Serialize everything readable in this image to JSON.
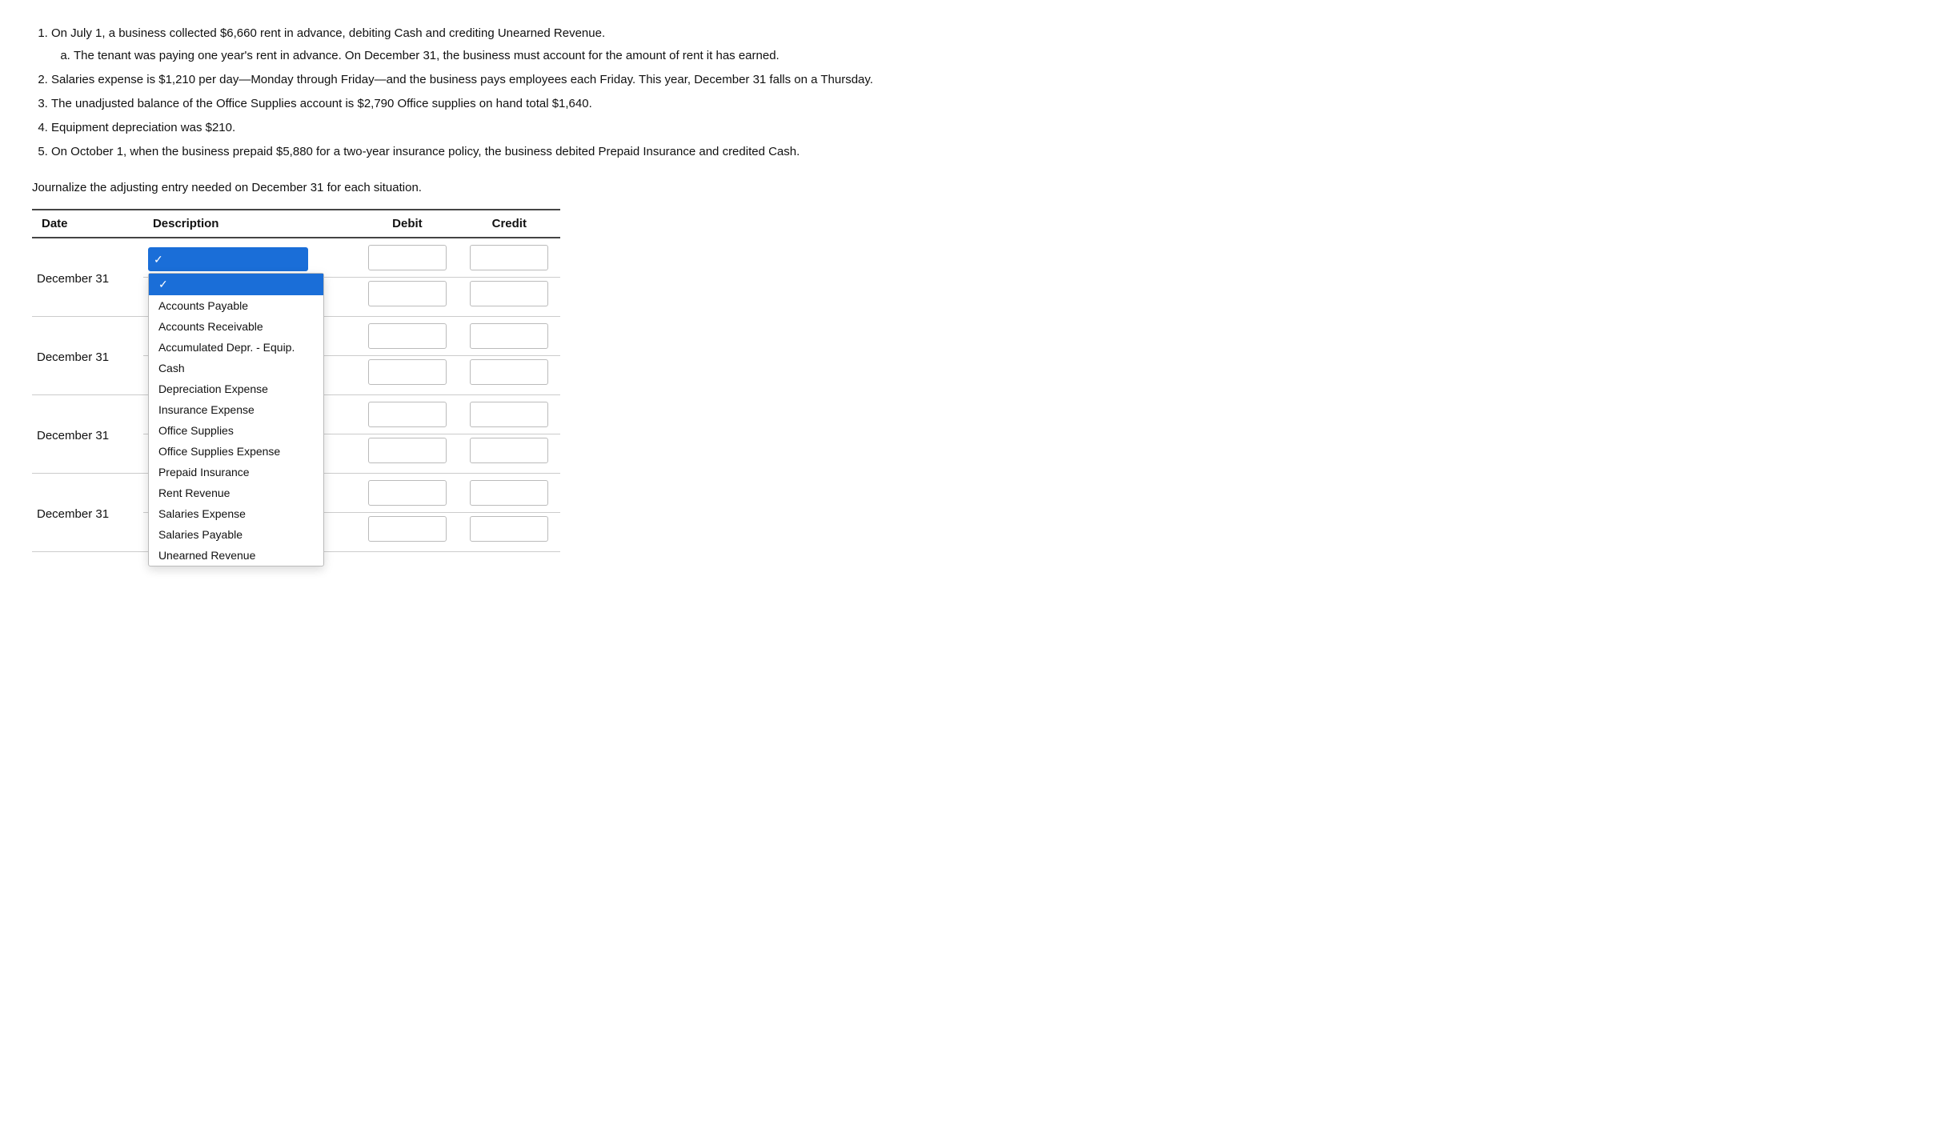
{
  "instructions": {
    "items": [
      {
        "text": "On July 1, a business collected $6,660 rent in advance, debiting Cash and crediting Unearned Revenue.",
        "sub": [
          "The tenant was paying one year's rent in advance. On December 31, the business must account for the amount of rent it has earned."
        ]
      },
      {
        "text": "Salaries expense is $1,210 per day—Monday through Friday—and the business pays employees each Friday. This year, December 31 falls on a Thursday.",
        "sub": []
      },
      {
        "text": "The unadjusted balance of the Office Supplies account is $2,790 Office supplies on hand total $1,640.",
        "sub": []
      },
      {
        "text": "Equipment depreciation was $210.",
        "sub": []
      },
      {
        "text": "On October 1, when the business prepaid $5,880 for a two-year insurance policy, the business debited Prepaid Insurance and credited Cash.",
        "sub": []
      }
    ]
  },
  "prompt": "Journalize the adjusting entry needed on December 31 for each situation.",
  "table": {
    "headers": {
      "date": "Date",
      "description": "Description",
      "debit": "Debit",
      "credit": "Credit"
    },
    "rows": [
      {
        "date": "December 31",
        "lines": [
          {
            "desc_selected": "",
            "desc_open": true,
            "debit": "",
            "credit": ""
          },
          {
            "desc_selected": "",
            "desc_open": false,
            "debit": "",
            "credit": "",
            "indented": true
          }
        ]
      },
      {
        "date": "December 31",
        "lines": [
          {
            "desc_selected": "",
            "desc_open": false,
            "debit": "",
            "credit": ""
          },
          {
            "desc_selected": "",
            "desc_open": false,
            "debit": "",
            "credit": "",
            "indented": true
          }
        ]
      },
      {
        "date": "December 31",
        "lines": [
          {
            "desc_selected": "",
            "desc_open": false,
            "debit": "",
            "credit": ""
          },
          {
            "desc_selected": "",
            "desc_open": false,
            "debit": "",
            "credit": "",
            "indented": true
          }
        ]
      },
      {
        "date": "December 31",
        "lines": [
          {
            "desc_selected": "",
            "desc_open": false,
            "debit": "",
            "credit": ""
          },
          {
            "desc_selected": "",
            "desc_open": false,
            "debit": "",
            "credit": "",
            "indented": true
          }
        ]
      }
    ]
  },
  "dropdown": {
    "options": [
      "Accounts Payable",
      "Accounts Receivable",
      "Accumulated Depr. - Equip.",
      "Cash",
      "Depreciation Expense",
      "Insurance Expense",
      "Office Supplies",
      "Office Supplies Expense",
      "Prepaid Insurance",
      "Rent Revenue",
      "Salaries Expense",
      "Salaries Payable",
      "Unearned Revenue"
    ]
  }
}
